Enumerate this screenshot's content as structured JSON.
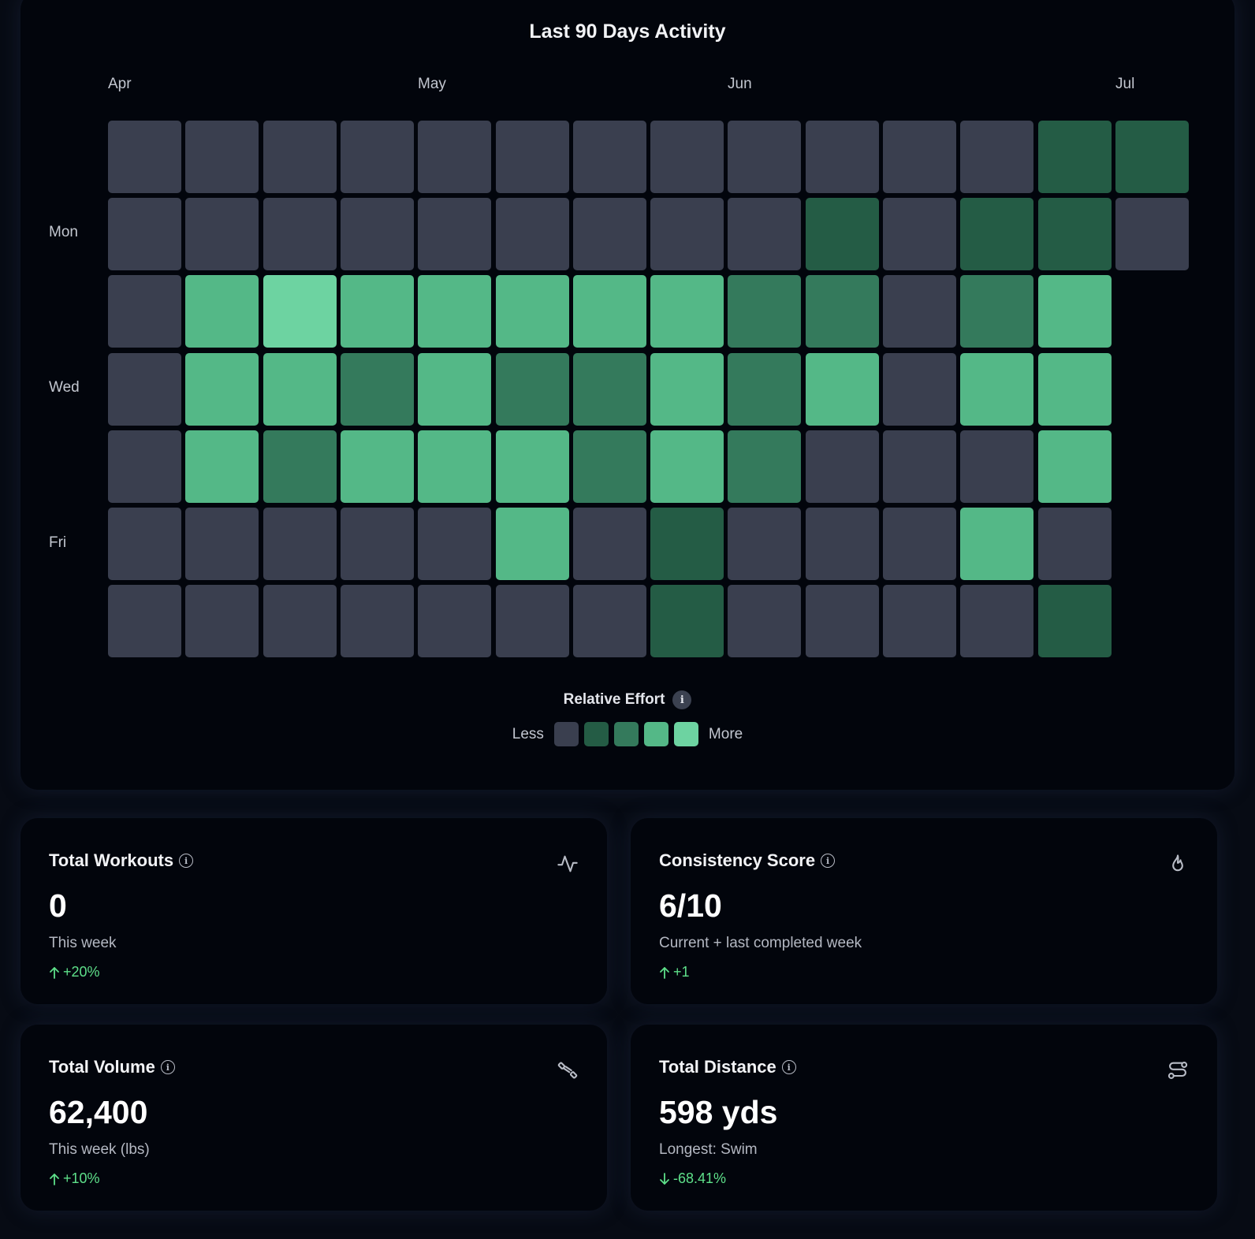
{
  "activity": {
    "title": "Last 90 Days Activity",
    "months": [
      "Apr",
      "May",
      "Jun",
      "Jul"
    ],
    "day_labels": [
      "Mon",
      "Wed",
      "Fri"
    ],
    "legend_title": "Relative Effort",
    "legend_less": "Less",
    "legend_more": "More",
    "level_colors": [
      "#3a3f4f",
      "#245c45",
      "#347a5c",
      "#54b887",
      "#6dd3a1"
    ]
  },
  "chart_data": {
    "type": "heatmap",
    "title": "Last 90 Days Activity",
    "x_tick_labels": [
      "Apr",
      "May",
      "Jun",
      "Jul"
    ],
    "y_tick_labels": [
      "Mon",
      "Wed",
      "Fri"
    ],
    "legend": [
      "Less",
      "More"
    ],
    "levels_by_week": [
      [
        0,
        0,
        0,
        0,
        0,
        0,
        0
      ],
      [
        0,
        0,
        3,
        3,
        3,
        0,
        0
      ],
      [
        0,
        0,
        4,
        3,
        2,
        0,
        0
      ],
      [
        0,
        0,
        3,
        2,
        3,
        0,
        0
      ],
      [
        0,
        0,
        3,
        3,
        3,
        0,
        0
      ],
      [
        0,
        0,
        3,
        2,
        3,
        3,
        0
      ],
      [
        0,
        0,
        3,
        2,
        2,
        0,
        0
      ],
      [
        0,
        0,
        3,
        3,
        3,
        1,
        1
      ],
      [
        0,
        0,
        2,
        2,
        2,
        0,
        0
      ],
      [
        0,
        1,
        2,
        3,
        0,
        0,
        0
      ],
      [
        0,
        0,
        0,
        0,
        0,
        0,
        0
      ],
      [
        0,
        1,
        2,
        3,
        0,
        3,
        0
      ],
      [
        1,
        1,
        3,
        3,
        3,
        0,
        1
      ],
      [
        1,
        0
      ]
    ]
  },
  "stats": [
    {
      "title": "Total Workouts",
      "icon": "activity-icon",
      "value": "0",
      "sub": "This week",
      "delta": "+20%",
      "direction": "up"
    },
    {
      "title": "Consistency Score",
      "icon": "flame-icon",
      "value": "6/10",
      "sub": "Current + last completed week",
      "delta": "+1",
      "direction": "up"
    },
    {
      "title": "Total Volume",
      "icon": "dumbbell-icon",
      "value": "62,400",
      "sub": "This week (lbs)",
      "delta": "+10%",
      "direction": "up"
    },
    {
      "title": "Total Distance",
      "icon": "route-icon",
      "value": "598 yds",
      "sub": "Longest: Swim",
      "delta": "-68.41%",
      "direction": "down"
    }
  ]
}
